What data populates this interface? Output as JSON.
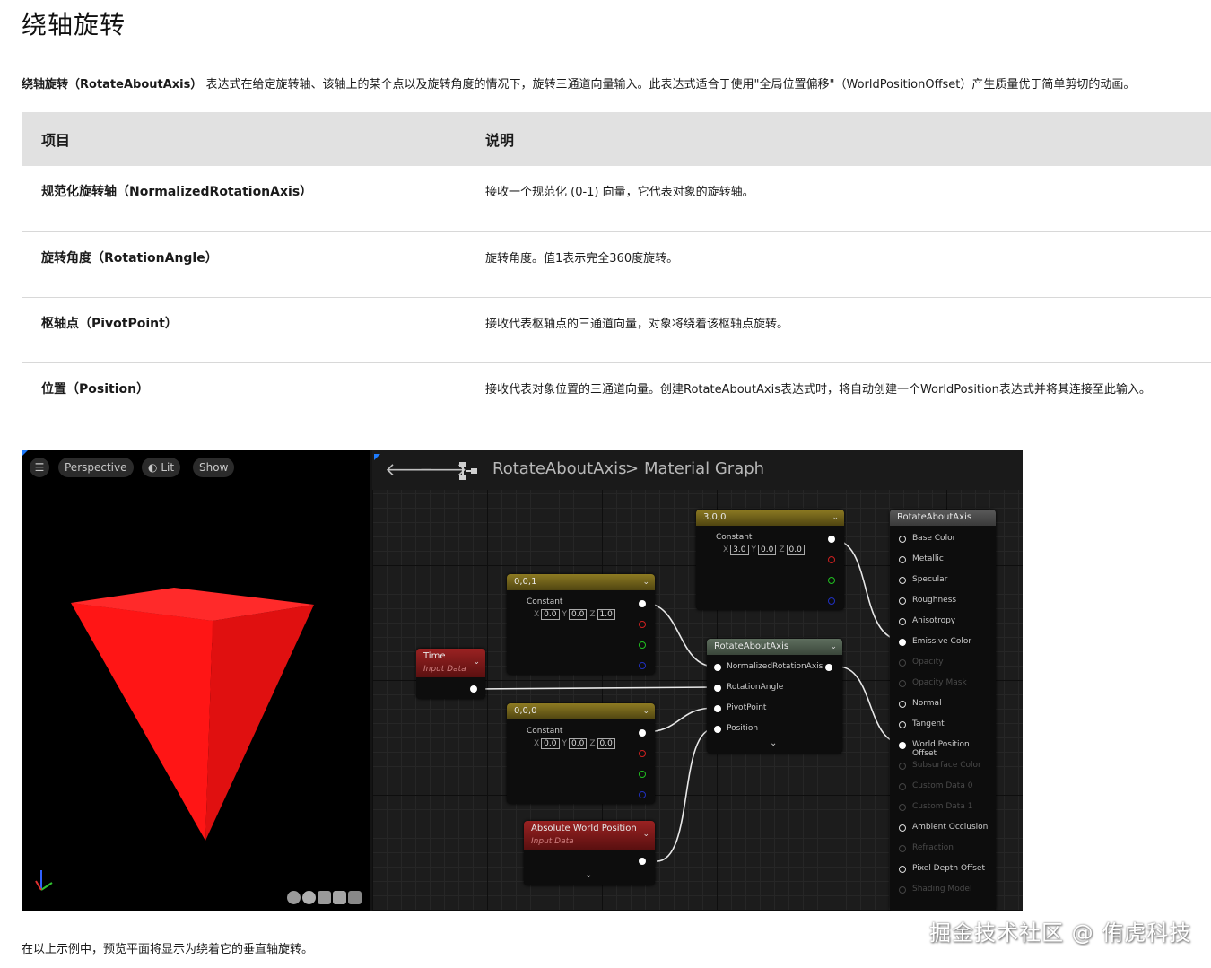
{
  "page": {
    "title": "绕轴旋转",
    "intro_term": "绕轴旋转（RotateAboutAxis）",
    "intro_text": "表达式在给定旋转轴、该轴上的某个点以及旋转角度的情况下，旋转三通道向量输入。此表达式适合于使用\"全局位置偏移\"（WorldPositionOffset）产生质量优于简单剪切的动画。",
    "footer": "在以上示例中，预览平面将显示为绕着它的垂直轴旋转。",
    "watermark": "掘金技术社区 @ 侑虎科技"
  },
  "table": {
    "headers": [
      "项目",
      "说明"
    ],
    "rows": [
      {
        "name": "规范化旋转轴（NormalizedRotationAxis）",
        "desc": "接收一个规范化 (0-1) 向量，它代表对象的旋转轴。"
      },
      {
        "name": "旋转角度（RotationAngle）",
        "desc": "旋转角度。值1表示完全360度旋转。"
      },
      {
        "name": "枢轴点（PivotPoint）",
        "desc": "接收代表枢轴点的三通道向量，对象将绕着该枢轴点旋转。"
      },
      {
        "name": "位置（Position）",
        "desc": "接收代表对象位置的三通道向量。创建RotateAboutAxis表达式时，将自动创建一个WorldPosition表达式并将其连接至此输入。"
      }
    ]
  },
  "viewport": {
    "menu_icon": "hamburger-icon",
    "perspective": "Perspective",
    "lit": "Lit",
    "show": "Show",
    "preview_color": "#ff1a1a"
  },
  "graph": {
    "breadcrumb_asset": "RotateAboutAxis",
    "breadcrumb_sep": ">",
    "breadcrumb_graph": "Material Graph",
    "nodes": {
      "const300": {
        "title": "3,0,0",
        "label": "Constant",
        "x": "3.0",
        "y": "0.0",
        "z": "0.0"
      },
      "const001": {
        "title": "0,0,1",
        "label": "Constant",
        "x": "0.0",
        "y": "0.0",
        "z": "1.0"
      },
      "const000": {
        "title": "0,0,0",
        "label": "Constant",
        "x": "0.0",
        "y": "0.0",
        "z": "0.0"
      },
      "time": {
        "title": "Time",
        "sub": "Input Data"
      },
      "awp": {
        "title": "Absolute World Position",
        "sub": "Input Data"
      },
      "rotate": {
        "title": "RotateAboutAxis",
        "inputs": [
          "NormalizedRotationAxis",
          "RotationAngle",
          "PivotPoint",
          "Position"
        ]
      },
      "result": {
        "title": "RotateAboutAxis",
        "pins": [
          "Base Color",
          "Metallic",
          "Specular",
          "Roughness",
          "Anisotropy",
          "Emissive Color",
          "Opacity",
          "Opacity Mask",
          "Normal",
          "Tangent",
          "World Position Offset",
          "Subsurface Color",
          "Custom Data 0",
          "Custom Data 1",
          "Ambient Occlusion",
          "Refraction",
          "Pixel Depth Offset",
          "Shading Model"
        ]
      }
    },
    "axis_labels": {
      "x": "X",
      "y": "Y",
      "z": "Z"
    }
  }
}
